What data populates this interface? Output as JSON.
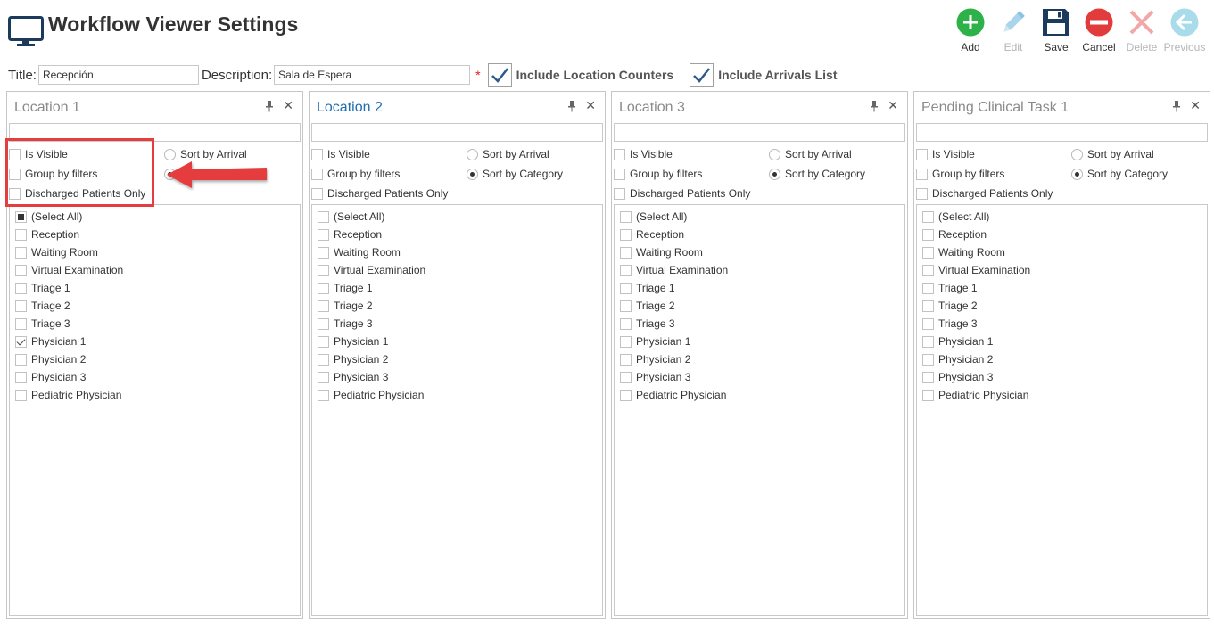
{
  "header": {
    "title": "Workflow Viewer Settings"
  },
  "toolbar": {
    "buttons": [
      {
        "label": "Add",
        "icon": "plus-icon",
        "enabled": true,
        "color": "#2db24a"
      },
      {
        "label": "Edit",
        "icon": "pencil-icon",
        "enabled": false,
        "color": "#a9d4ec"
      },
      {
        "label": "Save",
        "icon": "floppy-icon",
        "enabled": true,
        "color": "#1c3a5c"
      },
      {
        "label": "Cancel",
        "icon": "cancel-icon",
        "enabled": true,
        "color": "#e23b3b"
      },
      {
        "label": "Delete",
        "icon": "delete-x-icon",
        "enabled": false,
        "color": "#f1a8a8"
      },
      {
        "label": "Previous",
        "icon": "arrow-left-icon",
        "enabled": false,
        "color": "#a9dceb"
      }
    ]
  },
  "form": {
    "title_label": "Title:",
    "title_value": "Recepción",
    "description_label": "Description:",
    "description_value": "Sala de Espera",
    "required_marker": "*",
    "include_location_counters": {
      "label": "Include Location Counters",
      "checked": true
    },
    "include_arrivals_list": {
      "label": "Include Arrivals List",
      "checked": true
    }
  },
  "option_labels": {
    "is_visible": "Is Visible",
    "group_by_filters": "Group by filters",
    "discharged_only": "Discharged Patients Only",
    "sort_by_arrival": "Sort by Arrival",
    "sort_by_category": "Sort by Category"
  },
  "panels": [
    {
      "title": "Location 1",
      "active": false,
      "items": [
        {
          "label": "(Select All)",
          "state": "partial"
        },
        {
          "label": "Reception",
          "state": "unchecked"
        },
        {
          "label": "Waiting Room",
          "state": "unchecked"
        },
        {
          "label": "Virtual Examination",
          "state": "unchecked"
        },
        {
          "label": "Triage 1",
          "state": "unchecked"
        },
        {
          "label": "Triage 2",
          "state": "unchecked"
        },
        {
          "label": "Triage 3",
          "state": "unchecked"
        },
        {
          "label": "Physician 1",
          "state": "checked"
        },
        {
          "label": "Physician 2",
          "state": "unchecked"
        },
        {
          "label": "Physician 3",
          "state": "unchecked"
        },
        {
          "label": "Pediatric Physician",
          "state": "unchecked"
        }
      ]
    },
    {
      "title": "Location 2",
      "active": true,
      "items": [
        {
          "label": "(Select All)",
          "state": "unchecked"
        },
        {
          "label": "Reception",
          "state": "unchecked"
        },
        {
          "label": "Waiting Room",
          "state": "unchecked"
        },
        {
          "label": "Virtual Examination",
          "state": "unchecked"
        },
        {
          "label": "Triage 1",
          "state": "unchecked"
        },
        {
          "label": "Triage 2",
          "state": "unchecked"
        },
        {
          "label": "Triage 3",
          "state": "unchecked"
        },
        {
          "label": "Physician 1",
          "state": "unchecked"
        },
        {
          "label": "Physician 2",
          "state": "unchecked"
        },
        {
          "label": "Physician 3",
          "state": "unchecked"
        },
        {
          "label": "Pediatric Physician",
          "state": "unchecked"
        }
      ]
    },
    {
      "title": "Location 3",
      "active": false,
      "items": [
        {
          "label": "(Select All)",
          "state": "unchecked"
        },
        {
          "label": "Reception",
          "state": "unchecked"
        },
        {
          "label": "Waiting Room",
          "state": "unchecked"
        },
        {
          "label": "Virtual Examination",
          "state": "unchecked"
        },
        {
          "label": "Triage 1",
          "state": "unchecked"
        },
        {
          "label": "Triage 2",
          "state": "unchecked"
        },
        {
          "label": "Triage 3",
          "state": "unchecked"
        },
        {
          "label": "Physician 1",
          "state": "unchecked"
        },
        {
          "label": "Physician 2",
          "state": "unchecked"
        },
        {
          "label": "Physician 3",
          "state": "unchecked"
        },
        {
          "label": "Pediatric Physician",
          "state": "unchecked"
        }
      ]
    },
    {
      "title": "Pending Clinical Task 1",
      "active": false,
      "items": [
        {
          "label": "(Select All)",
          "state": "unchecked"
        },
        {
          "label": "Reception",
          "state": "unchecked"
        },
        {
          "label": "Waiting Room",
          "state": "unchecked"
        },
        {
          "label": "Virtual Examination",
          "state": "unchecked"
        },
        {
          "label": "Triage 1",
          "state": "unchecked"
        },
        {
          "label": "Triage 2",
          "state": "unchecked"
        },
        {
          "label": "Triage 3",
          "state": "unchecked"
        },
        {
          "label": "Physician 1",
          "state": "unchecked"
        },
        {
          "label": "Physician 2",
          "state": "unchecked"
        },
        {
          "label": "Physician 3",
          "state": "unchecked"
        },
        {
          "label": "Pediatric Physician",
          "state": "unchecked"
        }
      ]
    }
  ],
  "annotation": {
    "highlight_color": "#e53e3e"
  }
}
